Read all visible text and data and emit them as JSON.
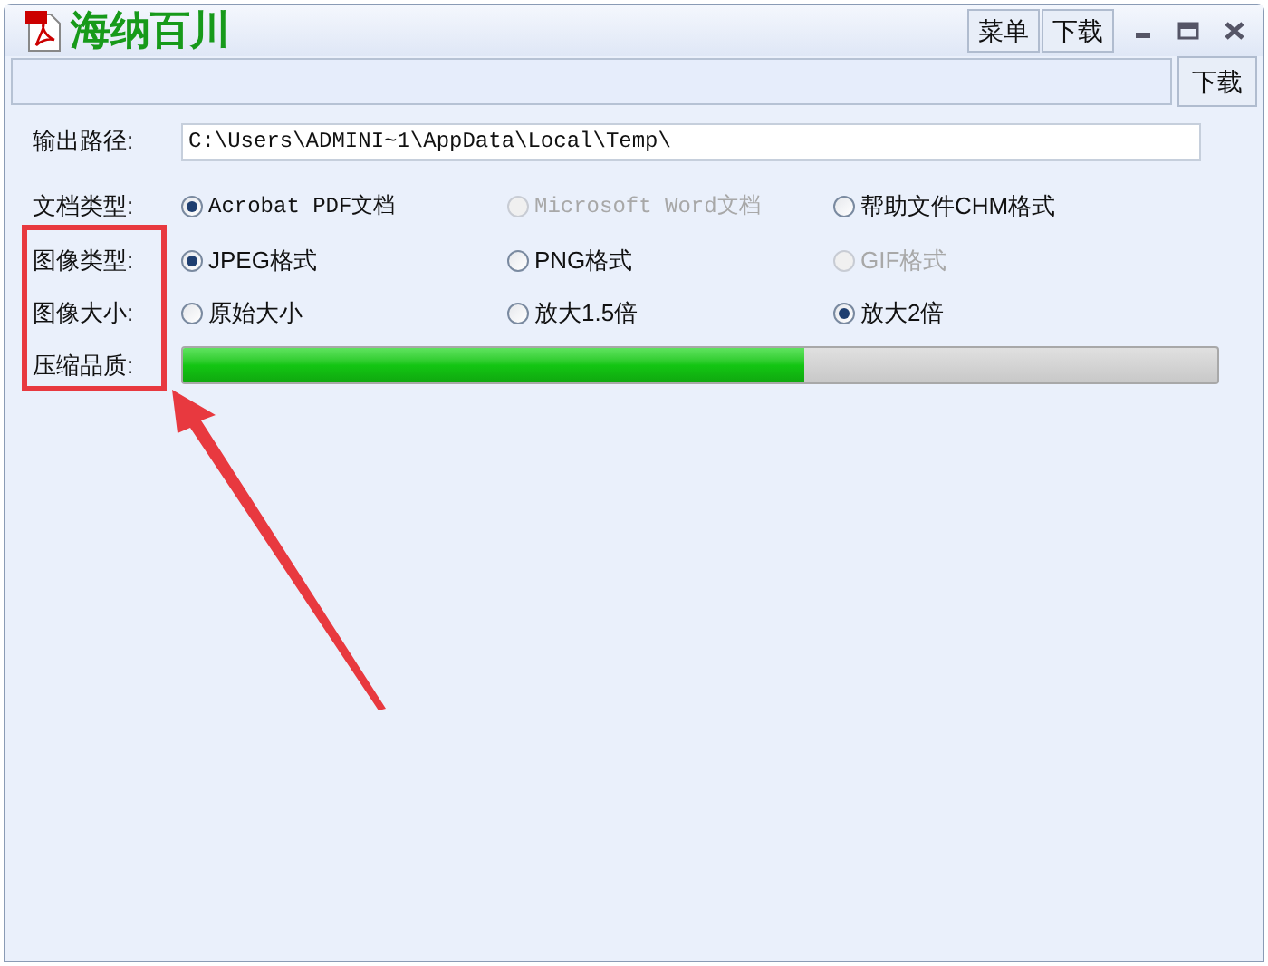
{
  "window": {
    "title": "海纳百川",
    "menu_buttons": [
      "菜单",
      "下载"
    ]
  },
  "toolbar": {
    "button": "下载"
  },
  "output_path": {
    "label": "输出路径:",
    "value": "C:\\Users\\ADMINI~1\\AppData\\Local\\Temp\\"
  },
  "option_rows": [
    {
      "label": "文档类型:",
      "options": [
        {
          "label": "Acrobat PDF文档",
          "selected": true,
          "disabled": false,
          "mono": true
        },
        {
          "label": "Microsoft Word文档",
          "selected": false,
          "disabled": true,
          "mono": true
        },
        {
          "label": "帮助文件CHM格式",
          "selected": false,
          "disabled": false,
          "mono": false
        }
      ]
    },
    {
      "label": "图像类型:",
      "options": [
        {
          "label": "JPEG格式",
          "selected": true,
          "disabled": false,
          "mono": false
        },
        {
          "label": "PNG格式",
          "selected": false,
          "disabled": false,
          "mono": false
        },
        {
          "label": "GIF格式",
          "selected": false,
          "disabled": true,
          "mono": false
        }
      ]
    },
    {
      "label": "图像大小:",
      "options": [
        {
          "label": "原始大小",
          "selected": false,
          "disabled": false,
          "mono": false
        },
        {
          "label": "放大1.5倍",
          "selected": false,
          "disabled": false,
          "mono": false
        },
        {
          "label": "放大2倍",
          "selected": true,
          "disabled": false,
          "mono": false
        }
      ]
    }
  ],
  "quality": {
    "label": "压缩品质:",
    "level": 0.6
  },
  "annotation": {
    "kind": "box-with-arrow"
  }
}
